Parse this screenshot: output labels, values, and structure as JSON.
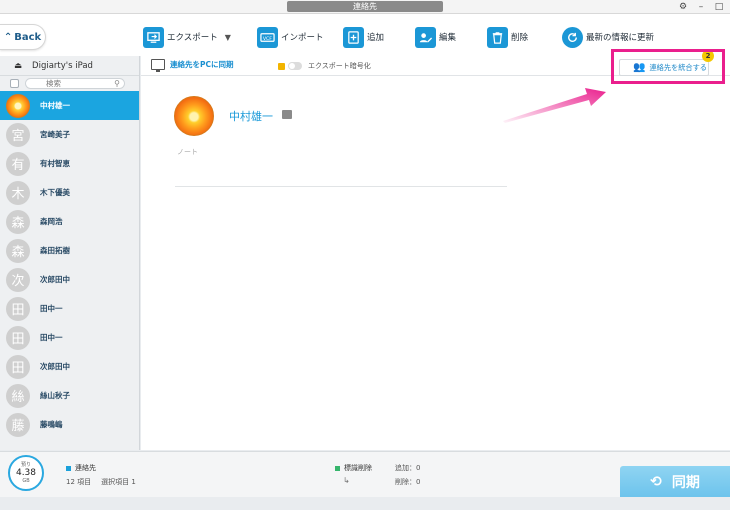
{
  "window": {
    "title": "連絡先",
    "controls": [
      "⚙",
      "–",
      "□"
    ]
  },
  "toolbar": {
    "back_label": "Back",
    "export_label": "エクスポート",
    "import_label": "インポート",
    "add_label": "追加",
    "edit_label": "編集",
    "delete_label": "削除",
    "refresh_label": "最新の情報に更新"
  },
  "sidebar": {
    "device_name": "Digiarty's iPad",
    "search_placeholder": "検索",
    "contacts": [
      {
        "initial": "",
        "name": "中村雄一",
        "active": true,
        "photo": true
      },
      {
        "initial": "宮",
        "name": "宮崎美子"
      },
      {
        "initial": "有",
        "name": "有村智恵"
      },
      {
        "initial": "木",
        "name": "木下優美"
      },
      {
        "initial": "森",
        "name": "森岡浩"
      },
      {
        "initial": "森",
        "name": "森田拓樹"
      },
      {
        "initial": "次",
        "name": "次郎田中"
      },
      {
        "initial": "田",
        "name": "田中一"
      },
      {
        "initial": "田",
        "name": "田中一"
      },
      {
        "initial": "田",
        "name": "次郎田中"
      },
      {
        "initial": "絲",
        "name": "絲山秋子"
      },
      {
        "initial": "藤",
        "name": "藤鳴嶋"
      }
    ]
  },
  "main": {
    "sync_pc_label": "連絡先をPCに同期",
    "encrypt_label": "エクスポート暗号化",
    "merge_label": "連絡先を統合する",
    "merge_badge": "2",
    "contact_name": "中村雄一",
    "note_placeholder": "ノート"
  },
  "status": {
    "storage_label": "預り",
    "storage_value": "4.38",
    "storage_unit": "GB",
    "category": "連絡先",
    "items": "12 項目",
    "selected": "選択項目 1",
    "mark_delete": "標識削除",
    "add_count": "追加：0",
    "delete_count": "削除：0",
    "sync_label": "同期"
  },
  "colors": {
    "accent": "#1ba5e0",
    "highlight": "#ea1f8d",
    "badge": "#f4c800"
  }
}
